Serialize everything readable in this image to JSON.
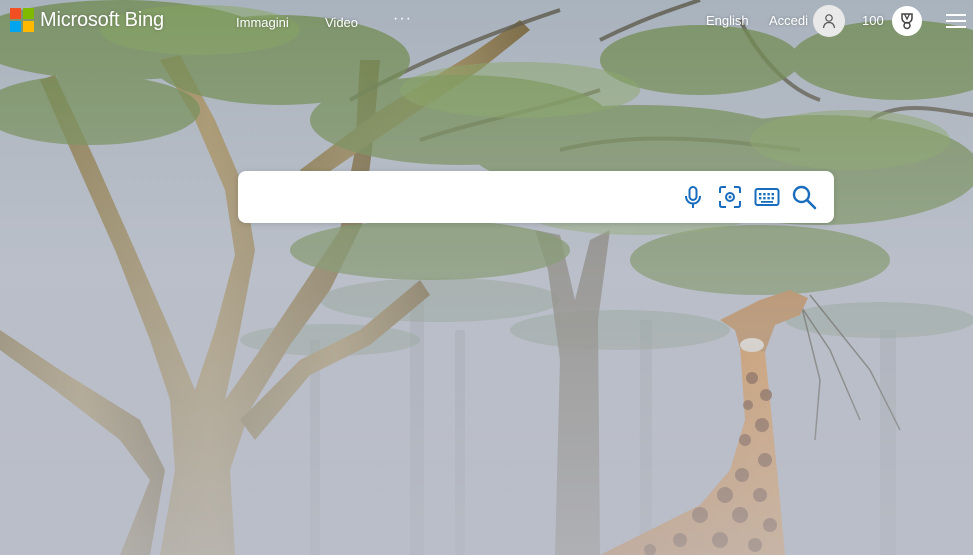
{
  "brand": {
    "name": "Microsoft Bing",
    "colors": [
      "#f25022",
      "#7fba00",
      "#00a4ef",
      "#ffb900"
    ]
  },
  "nav": {
    "images": "Immagini",
    "video": "Video",
    "more": "···"
  },
  "header": {
    "language": "English",
    "sign_in": "Accedi",
    "points": "100"
  },
  "search": {
    "placeholder": "",
    "value": ""
  },
  "icons": {
    "mic": "microphone-icon",
    "visual": "visual-search-icon",
    "keyboard": "keyboard-icon",
    "search": "search-icon",
    "avatar": "user-icon",
    "rewards": "rewards-trophy-icon",
    "menu": "hamburger-menu-icon"
  },
  "accent_color": "#1a6dbd"
}
